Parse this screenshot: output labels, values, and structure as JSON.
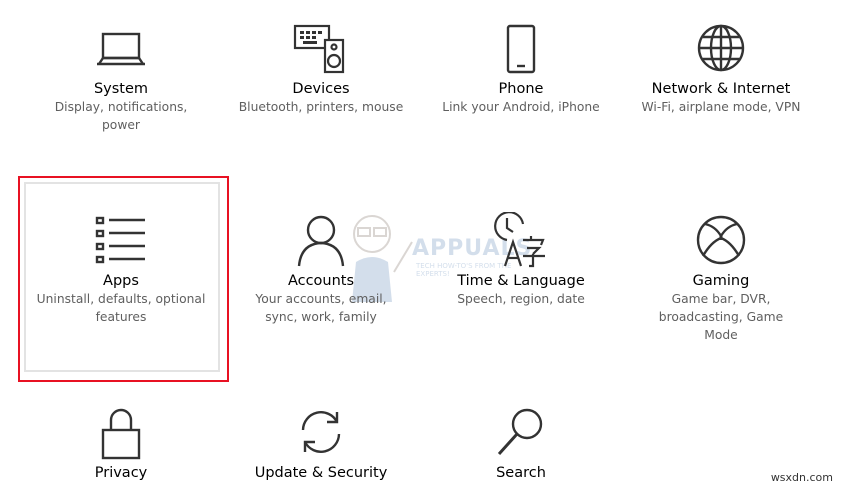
{
  "tiles": [
    {
      "name": "system",
      "title": "System",
      "desc": "Display, notifications, power",
      "icon": "laptop-icon"
    },
    {
      "name": "devices",
      "title": "Devices",
      "desc": "Bluetooth, printers, mouse",
      "icon": "keyboard-speaker-icon"
    },
    {
      "name": "phone",
      "title": "Phone",
      "desc": "Link your Android, iPhone",
      "icon": "phone-icon"
    },
    {
      "name": "network",
      "title": "Network & Internet",
      "desc": "Wi-Fi, airplane mode, VPN",
      "icon": "globe-icon"
    },
    {
      "name": "apps",
      "title": "Apps",
      "desc": "Uninstall, defaults, optional features",
      "icon": "apps-list-icon"
    },
    {
      "name": "accounts",
      "title": "Accounts",
      "desc": "Your accounts, email, sync, work, family",
      "icon": "person-icon"
    },
    {
      "name": "time-language",
      "title": "Time & Language",
      "desc": "Speech, region, date",
      "icon": "clock-language-icon"
    },
    {
      "name": "gaming",
      "title": "Gaming",
      "desc": "Game bar, DVR, broadcasting, Game Mode",
      "icon": "xbox-icon"
    },
    {
      "name": "privacy",
      "title": "Privacy",
      "desc": "",
      "icon": "lock-icon"
    },
    {
      "name": "update-security",
      "title": "Update & Security",
      "desc": "",
      "icon": "sync-arrows-icon"
    },
    {
      "name": "search",
      "title": "Search",
      "desc": "",
      "icon": "search-icon"
    }
  ],
  "selected_tile": "apps",
  "colors": {
    "highlight": "#e81123",
    "description_text": "#5f5f5f",
    "icon_stroke": "#333333"
  },
  "watermark": {
    "text": "APPUALS",
    "sub": "TECH HOW-TO'S FROM THE EXPERTS!"
  },
  "footer": {
    "text": "wsxdn.com"
  }
}
